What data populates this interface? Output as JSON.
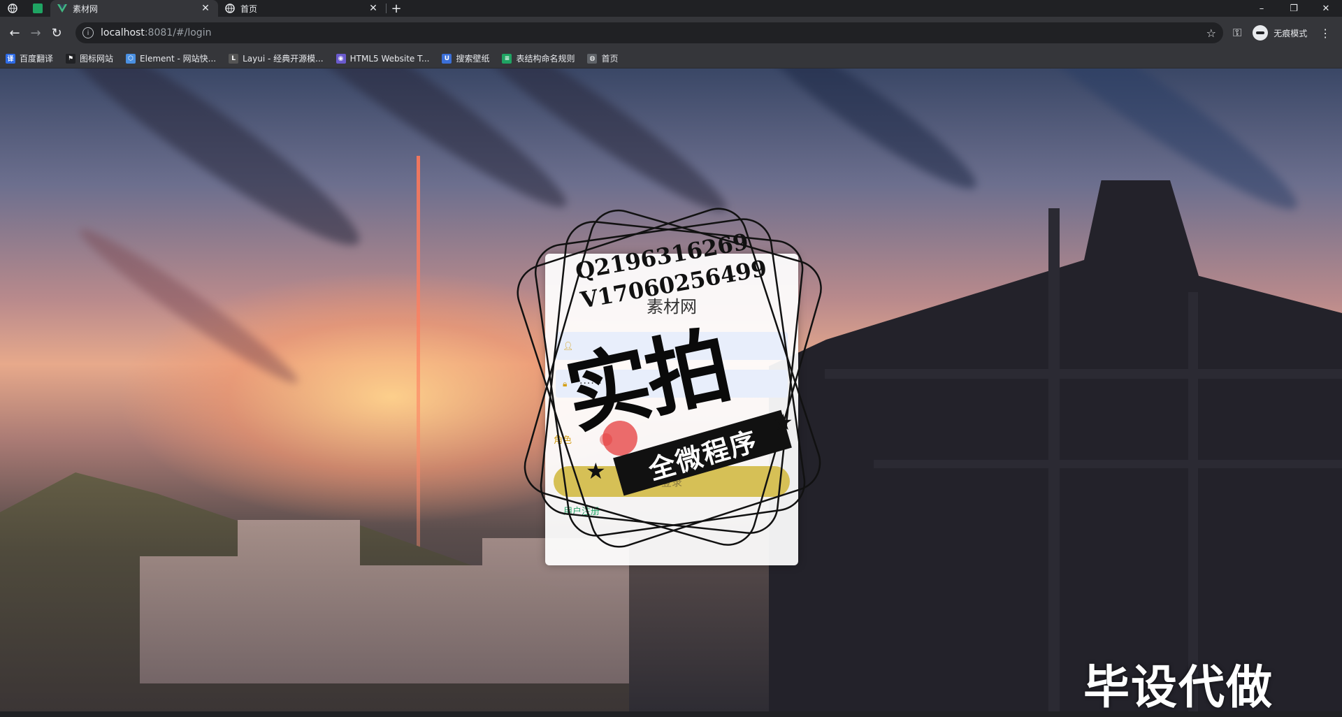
{
  "browser": {
    "tabs": [
      {
        "title": "素材网",
        "active": true
      },
      {
        "title": "首页",
        "active": false
      }
    ],
    "new_tab": "+",
    "window_controls": {
      "minimize": "–",
      "restore": "❐",
      "close": "✕"
    },
    "url_host": "localhost",
    "url_rest": ":8081/#/login",
    "incognito_label": "无痕模式",
    "bookmarks": [
      {
        "label": "百度翻译",
        "color": "#2e6be6",
        "glyph": "译"
      },
      {
        "label": "图标网站",
        "color": "#202124",
        "glyph": "⚑"
      },
      {
        "label": "Element - 网站快...",
        "color": "#4a90e2",
        "glyph": "⬡"
      },
      {
        "label": "Layui - 经典开源模...",
        "color": "#555",
        "glyph": "L"
      },
      {
        "label": "HTML5 Website T...",
        "color": "#6a5acd",
        "glyph": "◉"
      },
      {
        "label": "搜索壁纸",
        "color": "#3b6fd8",
        "glyph": "U"
      },
      {
        "label": "表结构命名规则",
        "color": "#1fa463",
        "glyph": "≡"
      },
      {
        "label": "首页",
        "color": "#5f6368",
        "glyph": "◍"
      }
    ]
  },
  "login": {
    "title": "素材网",
    "password_mask": "······",
    "role_label": "角色",
    "login_button": "登录",
    "register_link": "用户注册"
  },
  "watermark": {
    "line1": "Q2196316269",
    "line2": "V17060256499",
    "big": "实拍",
    "ribbon": "全微程序",
    "corner": "毕设代做"
  },
  "colors": {
    "accent_gold": "#d6c056",
    "register_green": "#2aa56a"
  }
}
